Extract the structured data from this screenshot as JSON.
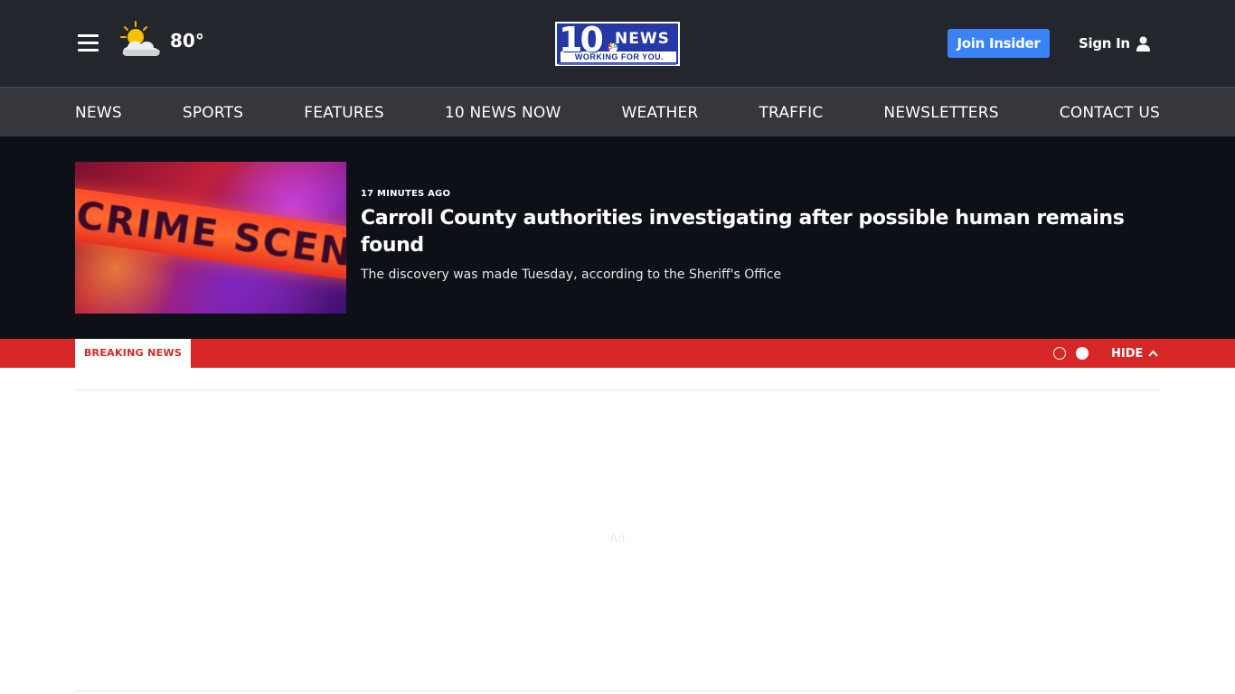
{
  "header": {
    "weather_temp": "80°",
    "weather_icon": "partly-cloudy-icon",
    "logo_number": "10",
    "logo_word": "NEWS",
    "logo_tagline": "WORKING FOR YOU.",
    "join_label": "Join Insider",
    "signin_label": "Sign In"
  },
  "nav": {
    "items": [
      "NEWS",
      "SPORTS",
      "FEATURES",
      "10 NEWS NOW",
      "WEATHER",
      "TRAFFIC",
      "NEWSLETTERS",
      "CONTACT US"
    ]
  },
  "breaking": {
    "image_text": "CRIME SCENE DO NOT",
    "time": "17 MINUTES AGO",
    "headline": "Carroll County authorities investigating after possible human remains found",
    "summary": "The discovery was made Tuesday, according to the Sheriff's Office",
    "label": "BREAKING NEWS",
    "hide_label": "HIDE"
  },
  "ad": {
    "label": "Ad"
  },
  "colors": {
    "header_bg": "#23262d",
    "nav_bg": "#35373c",
    "panel_bg": "#0d1016",
    "breaking_red": "#d72626",
    "join_blue": "#3b82f6"
  }
}
